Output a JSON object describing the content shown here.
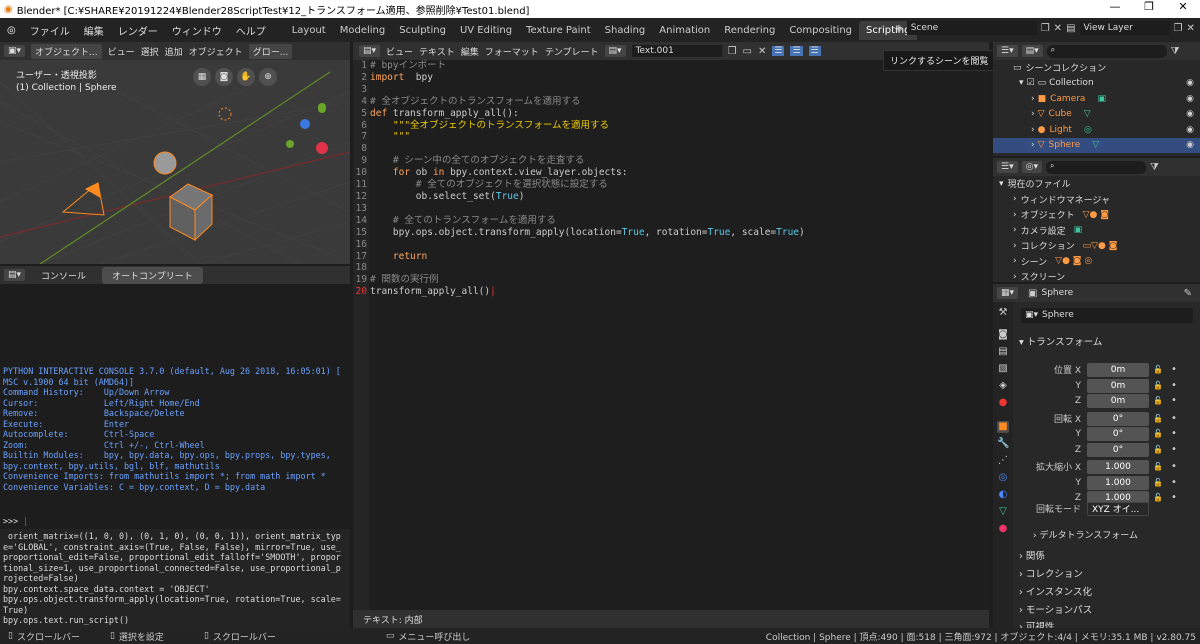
{
  "window": {
    "title": "Blender* [C:¥SHARE¥20191224¥Blender28ScriptTest¥12_トランスフォーム適用、参照削除¥Test01.blend]",
    "buttons": [
      "—",
      "❐",
      "✕"
    ]
  },
  "menu": [
    "ファイル",
    "編集",
    "レンダー",
    "ウィンドウ",
    "ヘルプ"
  ],
  "workspaces": [
    "Layout",
    "Modeling",
    "Sculpting",
    "UV Editing",
    "Texture Paint",
    "Shading",
    "Animation",
    "Rendering",
    "Compositing",
    "Scripting"
  ],
  "active_workspace": "Scripting",
  "scene": "Scene",
  "view_layer": "View Layer",
  "viewport": {
    "header": [
      "オブジェクト...",
      "ビュー",
      "選択",
      "追加",
      "オブジェクト",
      "グロー..."
    ],
    "title": "ユーザー・透視投影",
    "subtitle": "(1) Collection | Sphere"
  },
  "console": {
    "tabs": [
      "コンソール",
      "オートコンプリート"
    ],
    "intro": [
      "PYTHON INTERACTIVE CONSOLE 3.7.0 (default, Aug 26 2018, 16:05:01) [",
      "MSC v.1900 64 bit (AMD64)]",
      "",
      "Command History:    Up/Down Arrow",
      "Cursor:             Left/Right Home/End",
      "Remove:             Backspace/Delete",
      "Execute:            Enter",
      "Autocomplete:       Ctrl-Space",
      "Zoom:               Ctrl +/-, Ctrl-Wheel",
      "Builtin Modules:    bpy, bpy.data, bpy.ops, bpy.props, bpy.types,",
      "bpy.context, bpy.utils, bgl, blf, mathutils",
      "Convenience Imports: from mathutils import *; from math import *",
      "Convenience Variables: C = bpy.context, D = bpy.data"
    ],
    "prompt": ">>> ",
    "log": [
      " orient_matrix=((1, 0, 0), (0, 1, 0), (0, 0, 1)), orient_matrix_typ",
      "e='GLOBAL', constraint_axis=(True, False, False), mirror=True, use_",
      "proportional_edit=False, proportional_edit_falloff='SMOOTH', propor",
      "tional_size=1, use_proportional_connected=False, use_proportional_p",
      "rojected=False)",
      "bpy.context.space_data.context = 'OBJECT'",
      "bpy.ops.object.transform_apply(location=True, rotation=True, scale=",
      "True)",
      "bpy.ops.text.run_script()"
    ]
  },
  "editor": {
    "header": [
      "ビュー",
      "テキスト",
      "編集",
      "フォーマット",
      "テンプレート"
    ],
    "textname": "Text.001",
    "footer": "テキスト: 内部",
    "lines": [
      [
        [
          "c-com",
          "# bpyインポート"
        ]
      ],
      [
        [
          "c-kw",
          "import"
        ],
        [
          "",
          "  bpy"
        ]
      ],
      [],
      [
        [
          "c-com",
          "# 全オブジェクトのトランスフォームを適用する"
        ]
      ],
      [
        [
          "c-kw",
          "def"
        ],
        [
          "",
          " transform_apply_all():"
        ]
      ],
      [
        [
          "c-str",
          "    \"\"\"全オブジェクトのトランスフォームを適用する"
        ]
      ],
      [
        [
          "c-str",
          "    \"\"\""
        ]
      ],
      [],
      [
        [
          "c-com",
          "    # シーン中の全てのオブジェクトを走査する"
        ]
      ],
      [
        [
          "c-kw",
          "    for"
        ],
        [
          "",
          " ob "
        ],
        [
          "c-kw",
          "in"
        ],
        [
          "",
          " bpy.context.view_layer.objects:"
        ]
      ],
      [
        [
          "c-com",
          "        # 全てのオブジェクトを選択状態に設定する"
        ]
      ],
      [
        [
          "",
          "        ob.select_set("
        ],
        [
          "c-num",
          "True"
        ],
        [
          "",
          ")"
        ]
      ],
      [],
      [
        [
          "c-com",
          "    # 全てのトランスフォームを適用する"
        ]
      ],
      [
        [
          "",
          "    bpy.ops.object.transform_apply(location="
        ],
        [
          "c-num",
          "True"
        ],
        [
          "",
          ", rotation="
        ],
        [
          "c-num",
          "True"
        ],
        [
          "",
          ", scale="
        ],
        [
          "c-num",
          "True"
        ],
        [
          "",
          ")"
        ]
      ],
      [],
      [
        [
          "c-kw",
          "    return"
        ]
      ],
      [],
      [
        [
          "c-com",
          "# 関数の実行例"
        ]
      ],
      [
        [
          "",
          "transform_apply_all()"
        ]
      ]
    ]
  },
  "tooltip": "リンクするシーンを閲覧",
  "outliner": {
    "root": "シーンコレクション",
    "items": [
      "Collection",
      "Camera",
      "Cube",
      "Light",
      "Sphere"
    ]
  },
  "files": {
    "root": "現在のファイル",
    "items": [
      "ウィンドウマネージャ",
      "オブジェクト",
      "カメラ設定",
      "コレクション",
      "シーン",
      "スクリーン"
    ]
  },
  "props": {
    "object": "Sphere",
    "name": "Sphere",
    "section": "トランスフォーム",
    "rows": [
      [
        "位置 X",
        "0m"
      ],
      [
        "Y",
        "0m"
      ],
      [
        "Z",
        "0m"
      ],
      [
        "回転 X",
        "0°"
      ],
      [
        "Y",
        "0°"
      ],
      [
        "Z",
        "0°"
      ],
      [
        "拡大縮小 X",
        "1.000"
      ],
      [
        "Y",
        "1.000"
      ],
      [
        "Z",
        "1.000"
      ]
    ],
    "rotmode_label": "回転モード",
    "rotmode": "XYZ オイ...",
    "subsections": [
      "デルタトランスフォーム",
      "関係",
      "コレクション",
      "インスタンス化",
      "モーションパス",
      "可視性"
    ]
  },
  "statusbar": {
    "left": [
      "スクロールバー",
      "選択を設定",
      "スクロールバー",
      "メニュー呼び出し"
    ],
    "right": "Collection | Sphere | 頂点:490 | 面:518 | 三角面:972 | オブジェクト:4/4 | メモリ:35.1 MB | v2.80.75"
  }
}
